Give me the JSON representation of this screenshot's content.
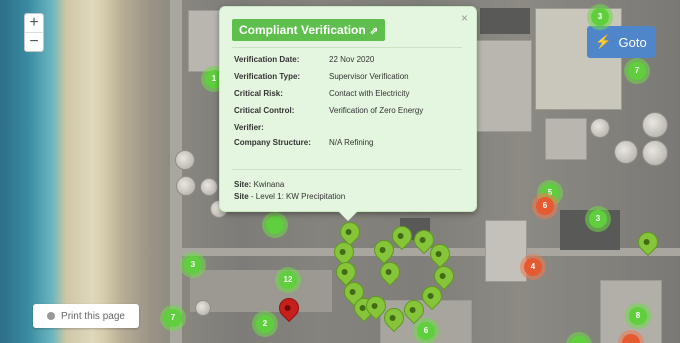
{
  "zoom": {
    "in_label": "+",
    "out_label": "−"
  },
  "goto": {
    "icon": "bolt-icon",
    "label": "Goto"
  },
  "print": {
    "label": "Print this page"
  },
  "popup": {
    "title": "Compliant Verification",
    "external_link_icon": "external-link-icon",
    "close": "×",
    "fields": [
      {
        "label": "Verification Date:",
        "value": "22 Nov 2020"
      },
      {
        "label": "Verification Type:",
        "value": "Supervisor Verification"
      },
      {
        "label": "Critical Risk:",
        "value": "Contact with Electricity"
      },
      {
        "label": "Critical Control:",
        "value": "Verification of Zero Energy"
      },
      {
        "label": "Verifier:",
        "value": ""
      },
      {
        "label": "Company Structure:",
        "value": "N/A Refining"
      }
    ],
    "site": {
      "label": "Site:",
      "value": "Kwinana"
    },
    "site2": {
      "label": "Site",
      "value": "- Level 1: KW Precipitation"
    }
  },
  "colors": {
    "compliant": "#5fcf3e",
    "non_compliant": "#e65a31",
    "pin_red": "#c7201c",
    "goto_blue": "#4f86c9"
  },
  "clusters": [
    {
      "label": "3",
      "status": "compliant"
    },
    {
      "label": "7",
      "status": "compliant"
    },
    {
      "label": "1",
      "status": "compliant"
    },
    {
      "label": "",
      "status": "compliant"
    },
    {
      "label": "3",
      "status": "compliant"
    },
    {
      "label": "12",
      "status": "compliant"
    },
    {
      "label": "5",
      "status": "compliant"
    },
    {
      "label": "6",
      "status": "non_compliant"
    },
    {
      "label": "4",
      "status": "non_compliant"
    },
    {
      "label": "3",
      "status": "compliant"
    },
    {
      "label": "7",
      "status": "compliant"
    },
    {
      "label": "2",
      "status": "compliant"
    },
    {
      "label": "8",
      "status": "compliant"
    },
    {
      "label": "6",
      "status": "compliant"
    },
    {
      "label": "",
      "status": "non_compliant"
    }
  ]
}
